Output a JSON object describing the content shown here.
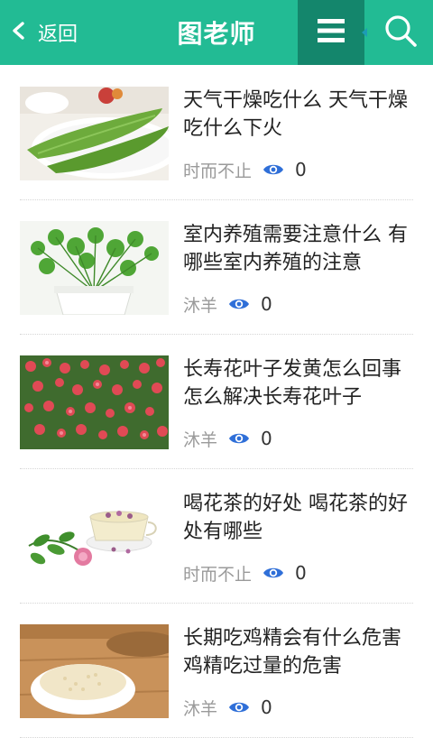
{
  "header": {
    "back_label": "返回",
    "title": "图老师",
    "icons": [
      "chevron-left-icon",
      "menu-icon",
      "search-icon"
    ],
    "accent_color": "#22bb94",
    "menu_bg_color": "#14866c"
  },
  "articles": [
    {
      "title": "天气干燥吃什么 天气干燥吃什么下火",
      "author": "时而不止",
      "views": "0",
      "image": "bitter-melon-on-plate"
    },
    {
      "title": "室内养殖需要注意什么 有哪些室内养殖的注意",
      "author": "沐羊",
      "views": "0",
      "image": "green-plant-in-pot"
    },
    {
      "title": "长寿花叶子发黄怎么回事 怎么解决长寿花叶子",
      "author": "沐羊",
      "views": "0",
      "image": "pink-kalanchoe-flowers"
    },
    {
      "title": "喝花茶的好处 喝花茶的好处有哪些",
      "author": "时而不止",
      "views": "0",
      "image": "flower-tea-and-rose"
    },
    {
      "title": "长期吃鸡精会有什么危害 鸡精吃过量的危害",
      "author": "沐羊",
      "views": "0",
      "image": "chicken-essence-in-bowl"
    }
  ]
}
